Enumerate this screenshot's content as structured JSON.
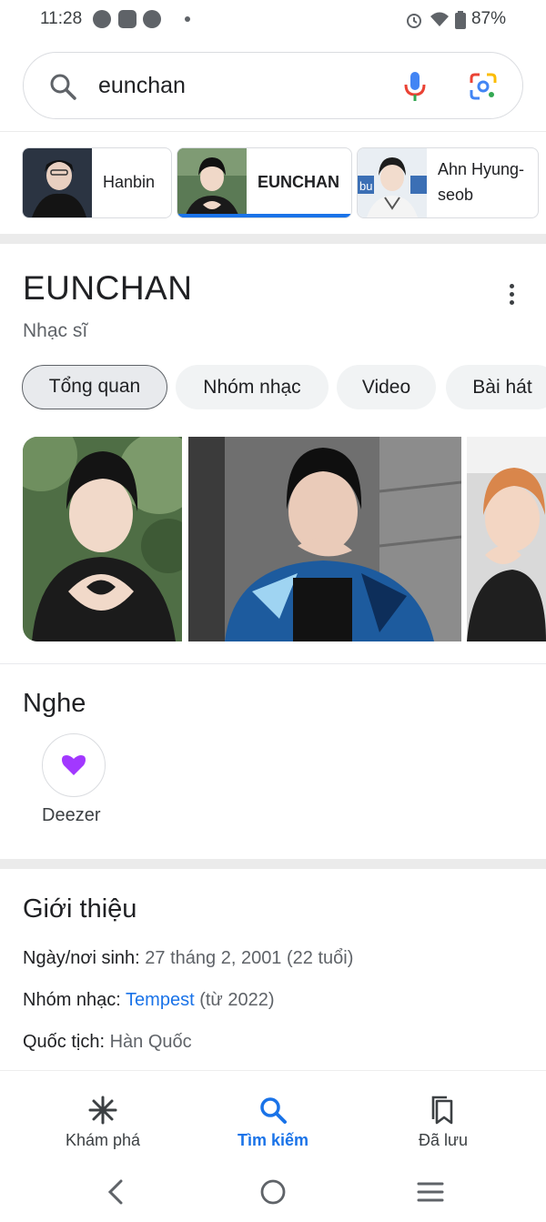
{
  "status_bar": {
    "time": "11:28",
    "notifications": [
      "messenger-icon",
      "zalo-icon",
      "compass-icon"
    ],
    "battery": "87%"
  },
  "search": {
    "query": "eunchan"
  },
  "entity_chips": [
    {
      "label": "Hanbin",
      "active": false
    },
    {
      "label": "EUNCHAN",
      "active": true
    },
    {
      "label": "Ahn Hyung-seob",
      "label_line1": "Ahn Hyung-",
      "label_line2": "seob",
      "active": false
    }
  ],
  "knowledge_panel": {
    "title": "EUNCHAN",
    "subtitle": "Nhạc sĩ",
    "tabs": [
      {
        "label": "Tổng quan",
        "active": true
      },
      {
        "label": "Nhóm nhạc",
        "active": false
      },
      {
        "label": "Video",
        "active": false
      },
      {
        "label": "Bài hát",
        "active": false
      }
    ]
  },
  "listen": {
    "title": "Nghe",
    "providers": [
      {
        "label": "Deezer",
        "icon": "deezer-heart-icon",
        "color": "#a238ff"
      }
    ]
  },
  "about": {
    "title": "Giới thiệu",
    "birth": {
      "label": "Ngày/nơi sinh:",
      "value": "27 tháng 2, 2001 (22 tuổi)"
    },
    "group": {
      "label": "Nhóm nhạc:",
      "link": "Tempest",
      "suffix": "(từ 2022)"
    },
    "nationality": {
      "label": "Quốc tịch:",
      "value": "Hàn Quốc"
    }
  },
  "bottom_nav": [
    {
      "label": "Khám phá",
      "icon": "discover-asterisk-icon",
      "active": false
    },
    {
      "label": "Tìm kiếm",
      "icon": "search-icon",
      "active": true
    },
    {
      "label": "Đã lưu",
      "icon": "bookmarks-icon",
      "active": false
    }
  ],
  "colors": {
    "accent": "#1a73e8",
    "chip_border": "#dadce0",
    "tab_bg": "#f1f3f4"
  }
}
